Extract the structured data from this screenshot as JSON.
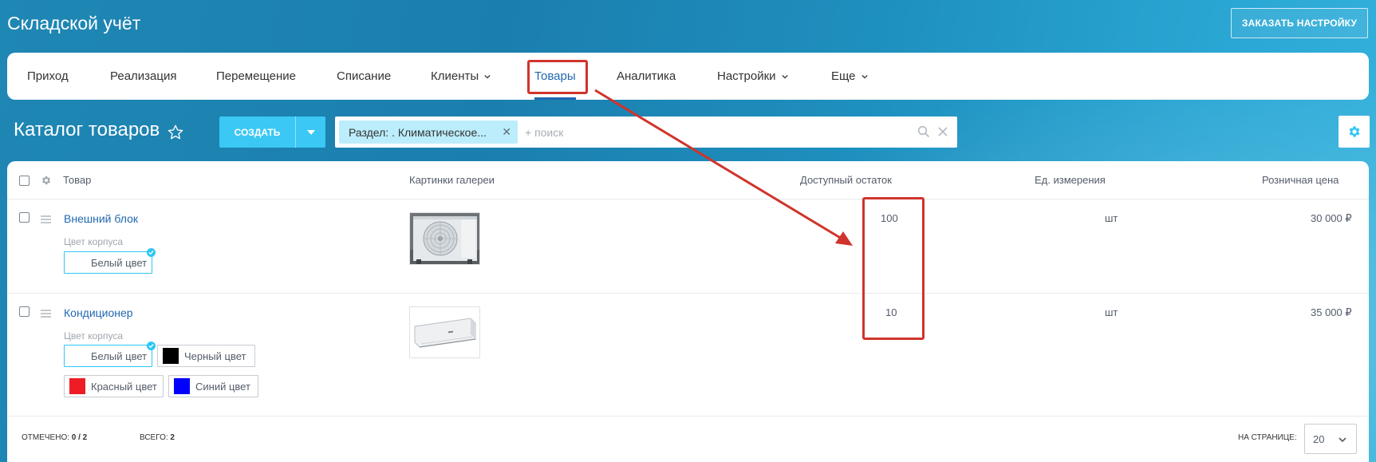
{
  "app": {
    "title": "Складской учёт",
    "order_button": "ЗАКАЗАТЬ НАСТРОЙКУ"
  },
  "nav": {
    "items": [
      {
        "label": "Приход"
      },
      {
        "label": "Реализация"
      },
      {
        "label": "Перемещение"
      },
      {
        "label": "Списание"
      },
      {
        "label": "Клиенты"
      },
      {
        "label": "Товары"
      },
      {
        "label": "Аналитика"
      },
      {
        "label": "Настройки"
      },
      {
        "label": "Еще"
      }
    ],
    "active": "Товары"
  },
  "catalog": {
    "title": "Каталог товаров",
    "create_button": "СОЗДАТЬ",
    "filter_chip": "Раздел: . Климатическое...",
    "search_placeholder": "+ поиск"
  },
  "table": {
    "columns": [
      "Товар",
      "Картинки галереи",
      "Доступный остаток",
      "Ед. измерения",
      "Розничная цена"
    ],
    "rows": [
      {
        "name": "Внешний блок",
        "prop_label": "Цвет корпуса",
        "swatches": [
          {
            "label": "Белый цвет",
            "color": "#ffffff",
            "selected": true
          }
        ],
        "image": "outdoor-ac-unit",
        "stock": "100",
        "unit": "шт",
        "price": "30 000 ₽"
      },
      {
        "name": "Кондиционер",
        "prop_label": "Цвет корпуса",
        "swatches": [
          {
            "label": "Белый цвет",
            "color": "#ffffff",
            "selected": true
          },
          {
            "label": "Черный цвет",
            "color": "#000000",
            "selected": false
          },
          {
            "label": "Красный цвет",
            "color": "#ee1c24",
            "selected": false
          },
          {
            "label": "Синий цвет",
            "color": "#0000ff",
            "selected": false
          }
        ],
        "image": "indoor-ac-unit",
        "stock": "10",
        "unit": "шт",
        "price": "35 000 ₽"
      }
    ]
  },
  "footer": {
    "selected_label": "ОТМЕЧЕНО:",
    "selected_value": "0 / 2",
    "total_label": "ВСЕГО:",
    "total_value": "2",
    "per_page_label": "НА СТРАНИЦЕ:",
    "per_page_value": "20"
  },
  "annotation_color": "#d0342c"
}
